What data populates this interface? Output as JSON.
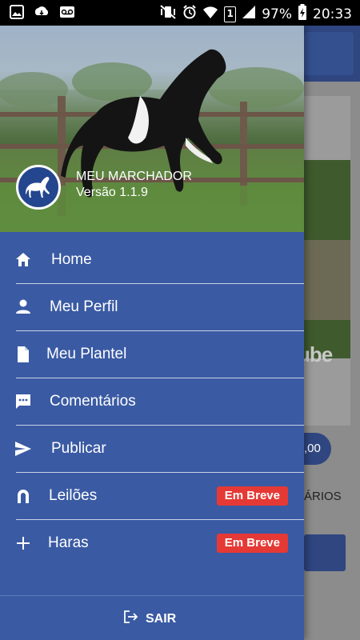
{
  "status_bar": {
    "battery": "97%",
    "time": "20:33",
    "sim": "1"
  },
  "drawer": {
    "app_name": "MEU MARCHADOR",
    "version": "Versão 1.1.9",
    "menu": [
      {
        "label": "Home",
        "icon": "home-icon"
      },
      {
        "label": "Meu Perfil",
        "icon": "person-icon"
      },
      {
        "label": "Meu Plantel",
        "icon": "document-icon"
      },
      {
        "label": "Comentários",
        "icon": "comment-icon"
      },
      {
        "label": "Publicar",
        "icon": "send-icon"
      },
      {
        "label": "Leilões",
        "icon": "horseshoe-icon",
        "badge": "Em Breve"
      },
      {
        "label": "Haras",
        "icon": "plus-icon",
        "badge": "Em Breve"
      }
    ],
    "logout_label": "SAIR"
  },
  "background": {
    "video_text": "ube",
    "price_text": ",00",
    "tab_text": "ÁRIOS"
  },
  "colors": {
    "drawer": "#3a5aa3",
    "header_bar": "#2f4680",
    "badge": "#e53935"
  }
}
